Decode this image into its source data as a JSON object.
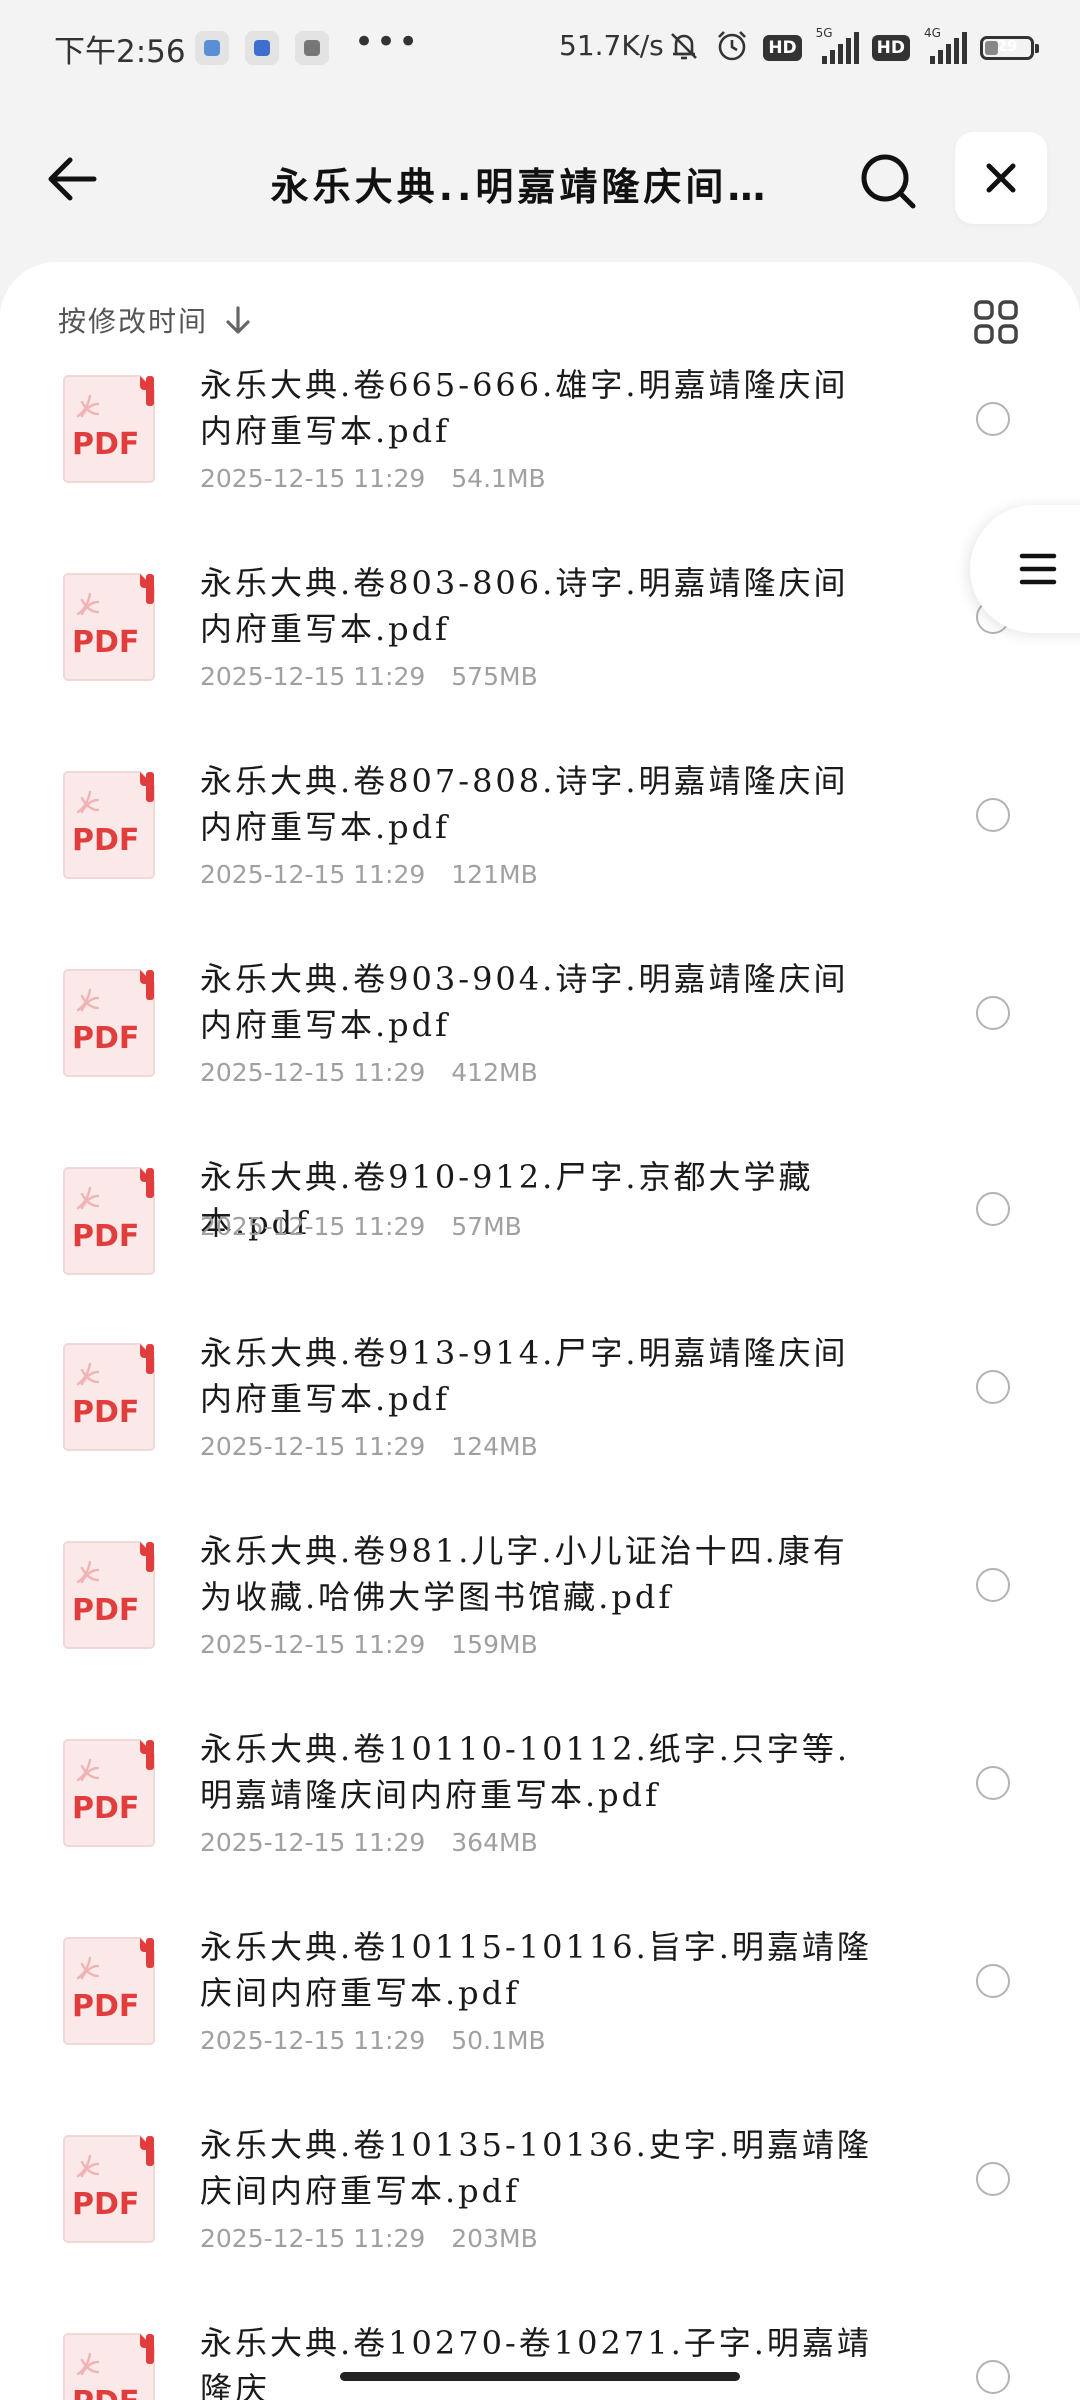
{
  "status_bar": {
    "time": "下午2:56",
    "dots": "•••",
    "net_speed": "51.7K/s",
    "hd1": "HD",
    "hd2": "HD",
    "net1": "5G",
    "net2": "4G",
    "battery": "29",
    "battery_level": 0.29,
    "icons": [
      "app-notification-icon",
      "message-notification-icon",
      "chat-notification-icon",
      "mute-bell-icon",
      "alarm-icon",
      "signal-icon",
      "battery-icon"
    ]
  },
  "header": {
    "title": "永乐大典..明嘉靖隆庆间…",
    "icons": [
      "back-arrow-icon",
      "search-icon",
      "close-icon"
    ]
  },
  "toolbar": {
    "sort_label": "按修改时间",
    "icons": [
      "sort-down-arrow-icon",
      "grid-view-icon",
      "list-menu-icon"
    ]
  },
  "files": [
    {
      "name": "永乐大典.卷665-666.雄字.明嘉靖隆庆间内府重写本.pdf",
      "date": "2025-12-15 11:29",
      "size": "54.1MB"
    },
    {
      "name": "永乐大典.卷803-806.诗字.明嘉靖隆庆间内府重写本.pdf",
      "date": "2025-12-15 11:29",
      "size": "575MB"
    },
    {
      "name": "永乐大典.卷807-808.诗字.明嘉靖隆庆间内府重写本.pdf",
      "date": "2025-12-15 11:29",
      "size": "121MB"
    },
    {
      "name": "永乐大典.卷903-904.诗字.明嘉靖隆庆间内府重写本.pdf",
      "date": "2025-12-15 11:29",
      "size": "412MB"
    },
    {
      "name": "永乐大典.卷910-912.尸字.京都大学藏本.pdf",
      "date": "2025-12-15 11:29",
      "size": "57MB"
    },
    {
      "name": "永乐大典.卷913-914.尸字.明嘉靖隆庆间内府重写本.pdf",
      "date": "2025-12-15 11:29",
      "size": "124MB"
    },
    {
      "name": "永乐大典.卷981.儿字.小儿证治十四.康有为收藏.哈佛大学图书馆藏.pdf",
      "date": "2025-12-15 11:29",
      "size": "159MB"
    },
    {
      "name": "永乐大典.卷10110-10112.纸字.只字等.明嘉靖隆庆间内府重写本.pdf",
      "date": "2025-12-15 11:29",
      "size": "364MB"
    },
    {
      "name": "永乐大典.卷10115-10116.旨字.明嘉靖隆庆间内府重写本.pdf",
      "date": "2025-12-15 11:29",
      "size": "50.1MB"
    },
    {
      "name": "永乐大典.卷10135-10136.史字.明嘉靖隆庆间内府重写本.pdf",
      "date": "2025-12-15 11:29",
      "size": "203MB"
    },
    {
      "name": "永乐大典.卷10270-卷10271.子字.明嘉靖隆庆",
      "date": "",
      "size": ""
    }
  ],
  "pdf_icon_label": "PDF",
  "colors": {
    "pdf_red": "#e23d3d",
    "icon_bg": "#fbe9e9",
    "meta_gray": "#a0a0a0",
    "page_bg": "#f3f3f3"
  }
}
